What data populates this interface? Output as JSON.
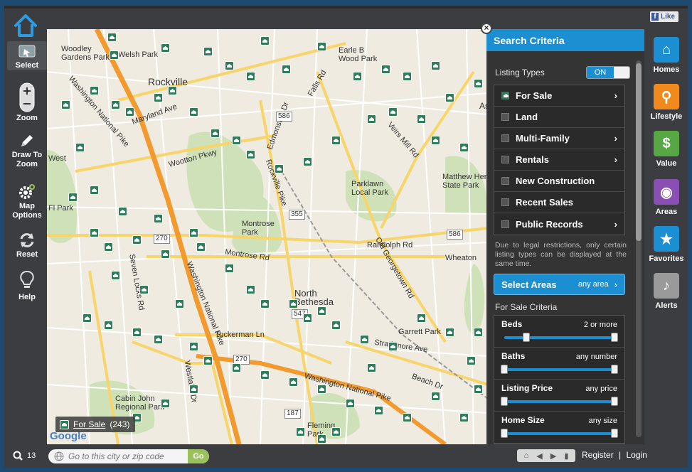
{
  "toolbar": {
    "select": "Select",
    "zoom": "Zoom",
    "draw_line1": "Draw To",
    "draw_line2": "Zoom",
    "map_opt_line1": "Map",
    "map_opt_line2": "Options",
    "reset": "Reset",
    "help": "Help"
  },
  "map": {
    "labels": {
      "woodley": "Woodley\nGardens Park",
      "welsh": "Welsh Park",
      "rockville": "Rockville",
      "earle": "Earle B\nWood Park",
      "maryland": "Maryland Ave",
      "west": "West",
      "fpark": "Fl Park",
      "wootton": "Wootton Pkwy",
      "parklawn": "Parklawn\nLocal Park",
      "mathew": "Matthew Henson\nState Park",
      "montrose": "Montrose\nPark",
      "montrose_rd": "Montrose Rd",
      "randolph": "Randolph Rd",
      "north_bethesda": "North\nBethesda",
      "garrett": "Garrett Park",
      "strathmore": "Strathmore Ave",
      "tuckerman": "Tuckerman Ln",
      "cabin_john": "Cabin John\nRegional Park",
      "fleming": "Fleming\nPark",
      "beach": "Beach Dr",
      "veirs": "Veirs Mill Rd",
      "wash_pike": "Washington National Pike",
      "rockville_pike": "Rockville Pike",
      "seven_locks": "Seven Locks Rd",
      "westlake": "Westlake Dr",
      "r586": "586",
      "r355": "355",
      "r270": "270",
      "r187": "187",
      "r547": "547",
      "ed": "Edmonston Dr",
      "falls": "Falls Rd",
      "old_georgetown": "Old Georgetown Rd",
      "asp": "Asp",
      "wheaton": "Wheaton"
    },
    "status": {
      "link": "For Sale",
      "count": "(243)"
    },
    "provider": "Google"
  },
  "panel": {
    "title": "Search Criteria",
    "listing_types_label": "Listing Types",
    "toggle_on": "ON",
    "listing_types": [
      {
        "label": "For Sale",
        "checked": true,
        "chevron": true
      },
      {
        "label": "Land",
        "checked": false,
        "chevron": false
      },
      {
        "label": "Multi-Family",
        "checked": false,
        "chevron": true
      },
      {
        "label": "Rentals",
        "checked": false,
        "chevron": true
      },
      {
        "label": "New Construction",
        "checked": false,
        "chevron": false
      },
      {
        "label": "Recent Sales",
        "checked": false,
        "chevron": false
      },
      {
        "label": "Public Records",
        "checked": false,
        "chevron": true
      }
    ],
    "note": "Due to legal restrictions, only certain listing types can be displayed at the same time.",
    "select_areas": {
      "label": "Select Areas",
      "value": "any area"
    },
    "criteria_title": "For Sale Criteria",
    "criteria": [
      {
        "name": "Beds",
        "value": "2 or more",
        "min_fraction": 0.2
      },
      {
        "name": "Baths",
        "value": "any number",
        "min_fraction": 0
      },
      {
        "name": "Listing Price",
        "value": "any price",
        "min_fraction": 0
      },
      {
        "name": "Home Size",
        "value": "any size",
        "min_fraction": 0
      }
    ]
  },
  "right_nav": [
    {
      "label": "Homes",
      "icon": "house-icon",
      "color": "#1b8fd2"
    },
    {
      "label": "Lifestyle",
      "icon": "bicycle-icon",
      "color": "#f08a1c"
    },
    {
      "label": "Value",
      "icon": "house-dollar-icon",
      "color": "#57a844"
    },
    {
      "label": "Areas",
      "icon": "map-pin-icon",
      "color": "#8a4fb3"
    },
    {
      "label": "Favorites",
      "icon": "folder-star-icon",
      "color": "#1b8fd2"
    },
    {
      "label": "Alerts",
      "icon": "bell-icon",
      "color": "#9a9a9a"
    }
  ],
  "facebook": {
    "label": "Like"
  },
  "bottom": {
    "zoom_level": "13",
    "search_placeholder": "Go to this city or zip code",
    "go": "Go",
    "register": "Register",
    "separator": "|",
    "login": "Login"
  }
}
